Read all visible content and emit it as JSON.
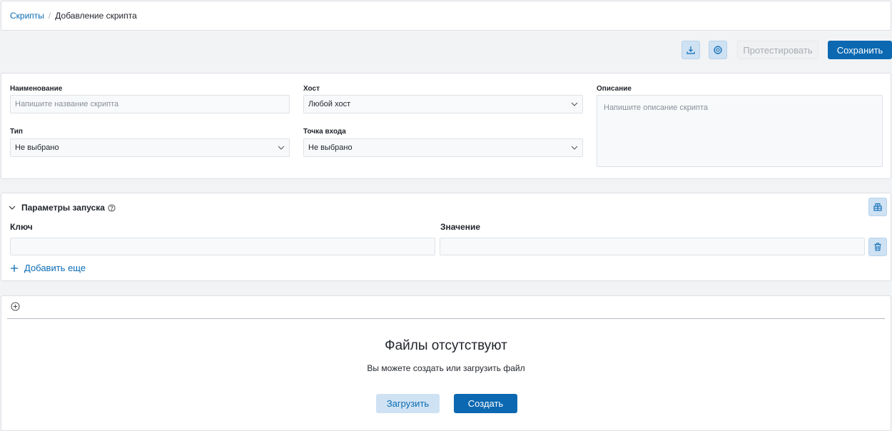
{
  "breadcrumb": {
    "parent": "Скрипты",
    "separator": "/",
    "current": "Добавление скрипта"
  },
  "toolbar": {
    "download_icon": "download-icon",
    "settings_icon": "gear-icon",
    "test_label": "Протестировать",
    "save_label": "Сохранить"
  },
  "form": {
    "name": {
      "label": "Наименование",
      "placeholder": "Напишите название скрипта"
    },
    "host": {
      "label": "Хост",
      "value": "Любой хост"
    },
    "description": {
      "label": "Описание",
      "placeholder": "Напишите описание скрипта"
    },
    "type": {
      "label": "Тип",
      "value": "Не выбрано"
    },
    "entry_point": {
      "label": "Точка входа",
      "value": "Не выбрано"
    }
  },
  "params": {
    "title": "Параметры запуска",
    "key_header": "Ключ",
    "value_header": "Значение",
    "add_more": "Добавить еще"
  },
  "files": {
    "empty_title": "Файлы отсутствуют",
    "empty_subtitle": "Вы можете создать или загрузить файл",
    "upload_label": "Загрузить",
    "create_label": "Создать"
  },
  "colors": {
    "accent": "#0b68b1",
    "accent_light": "#cfe2f3"
  }
}
